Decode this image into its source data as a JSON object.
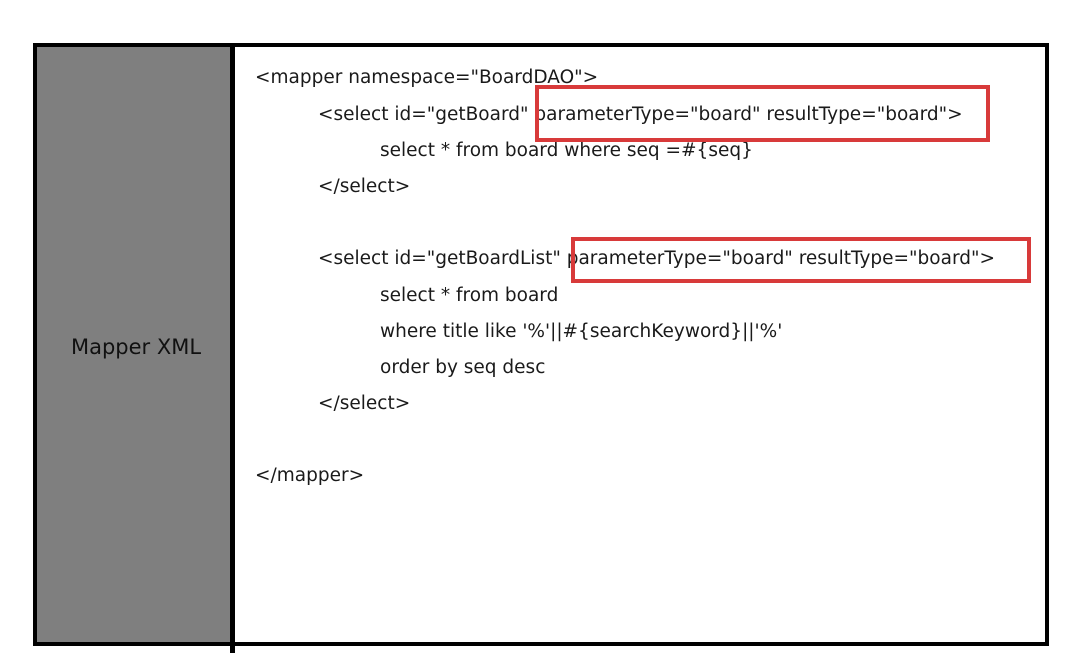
{
  "sidebar": {
    "label": "Mapper XML"
  },
  "code": {
    "lines": [
      "<mapper namespace=\"BoardDAO\">",
      "<select id=\"getBoard\" parameterType=\"board\" resultType=\"board\">",
      "select * from board where seq =#{seq}",
      "</select>",
      "<select id=\"getBoardList\" parameterType=\"board\" resultType=\"board\">",
      "select * from board",
      "where title like '%'||#{searchKeyword}||'%'",
      "order by seq desc",
      "</select>",
      "</mapper>"
    ]
  },
  "highlight_color": "#d83a3a"
}
